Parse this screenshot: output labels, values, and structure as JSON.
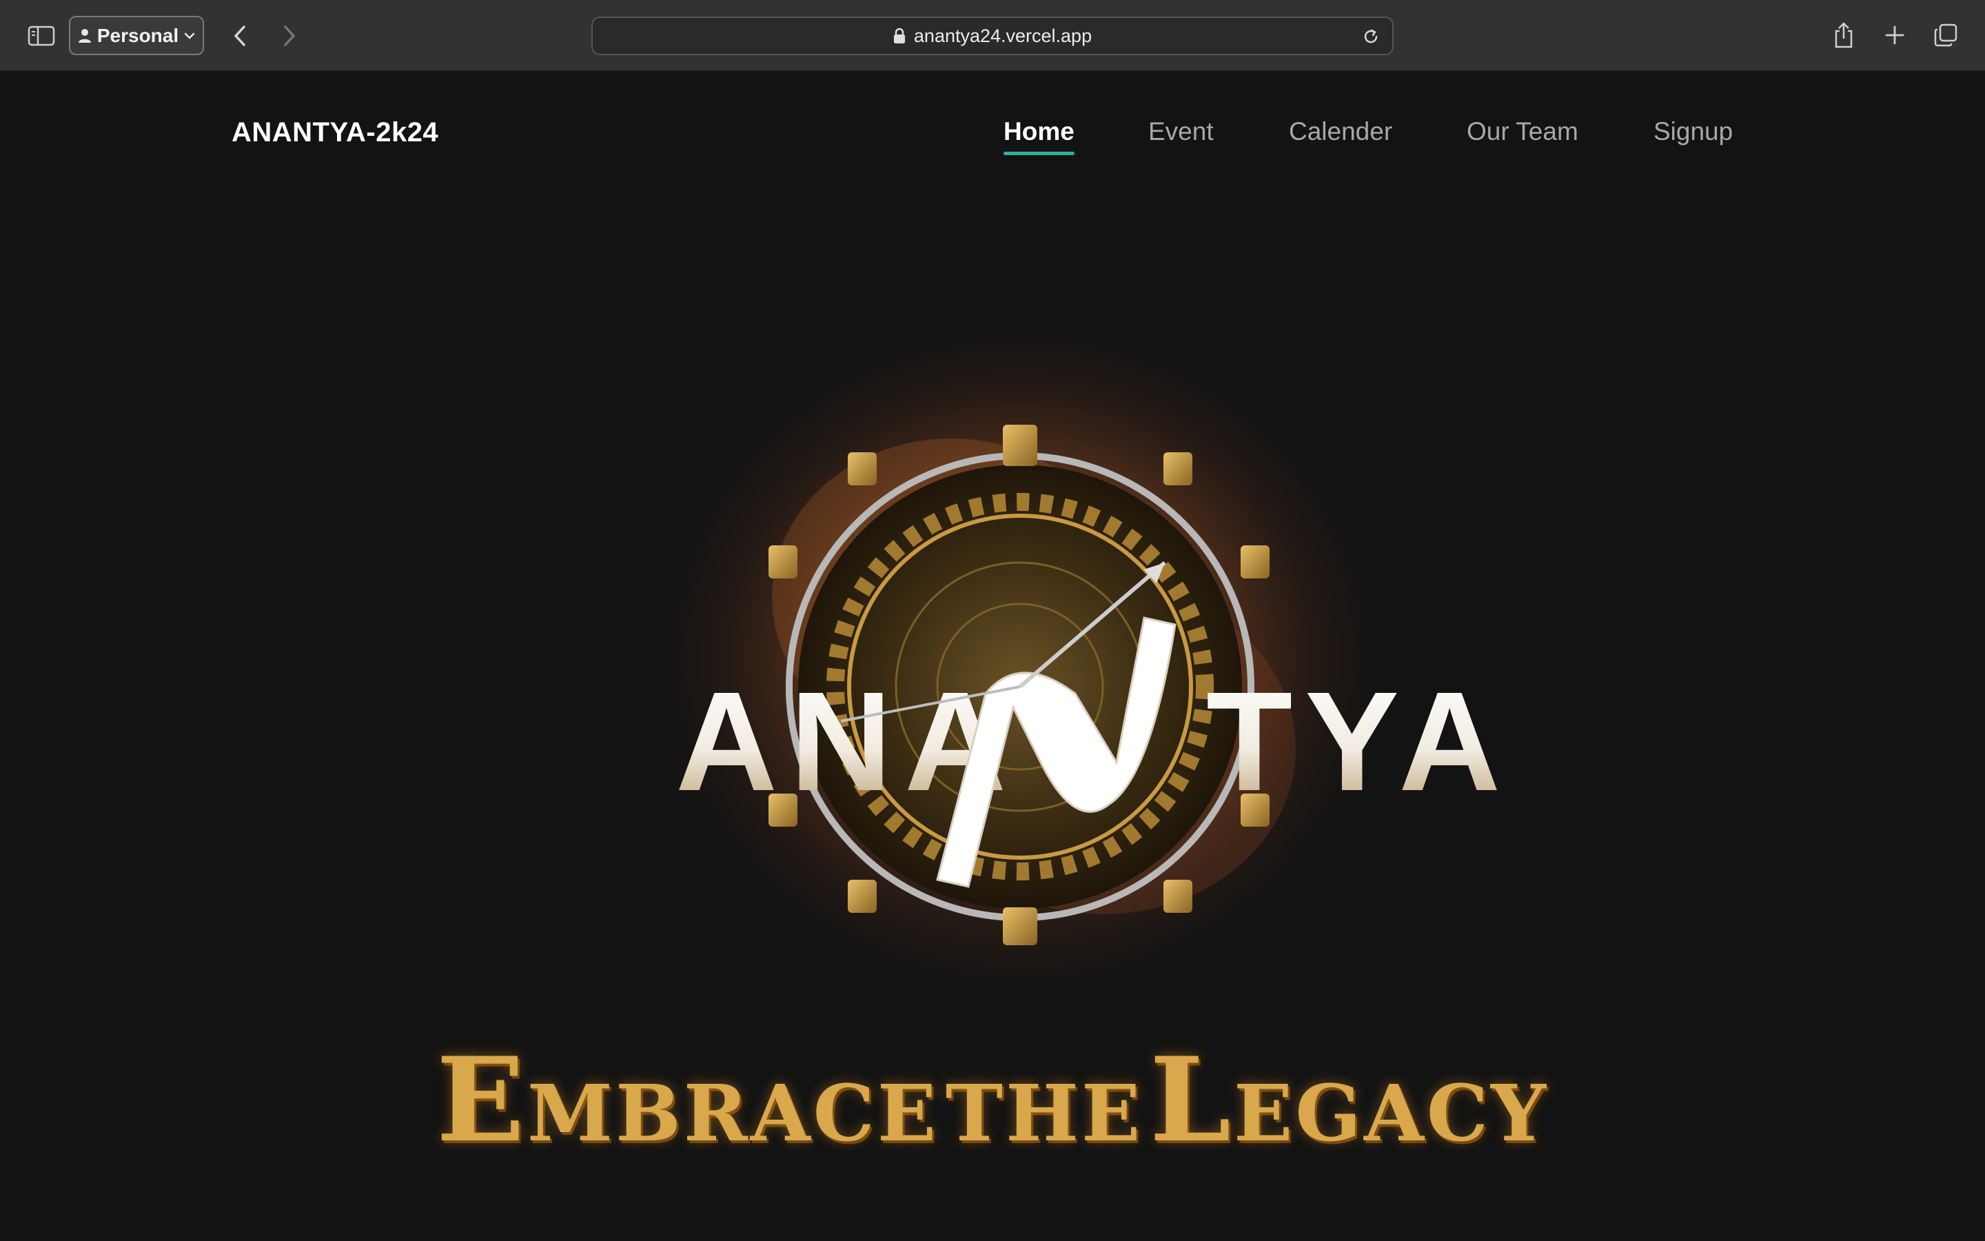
{
  "browser": {
    "profile_label": "Personal",
    "url": "anantya24.vercel.app",
    "icons": [
      "sidebar-icon",
      "person-icon",
      "chevron-down-icon",
      "back-icon",
      "forward-icon",
      "lock-icon",
      "reload-icon",
      "share-icon",
      "plus-icon",
      "tabs-overview-icon"
    ]
  },
  "site": {
    "title": "ANANTYA-2k24"
  },
  "nav": {
    "items": [
      {
        "label": "Home",
        "active": true
      },
      {
        "label": "Event",
        "active": false
      },
      {
        "label": "Calender",
        "active": false
      },
      {
        "label": "Our Team",
        "active": false
      },
      {
        "label": "Signup",
        "active": false
      }
    ]
  },
  "hero": {
    "logo_text_left": "ANA",
    "logo_text_right": "TYA",
    "tagline_line": "Embrace the Legacy",
    "tagline_parts": [
      "E",
      "MBRACE",
      "THE",
      "L",
      "EGACY"
    ]
  },
  "colors": {
    "accent": "#2bb3a0",
    "background": "#131313",
    "gold": "#d9a74c"
  }
}
